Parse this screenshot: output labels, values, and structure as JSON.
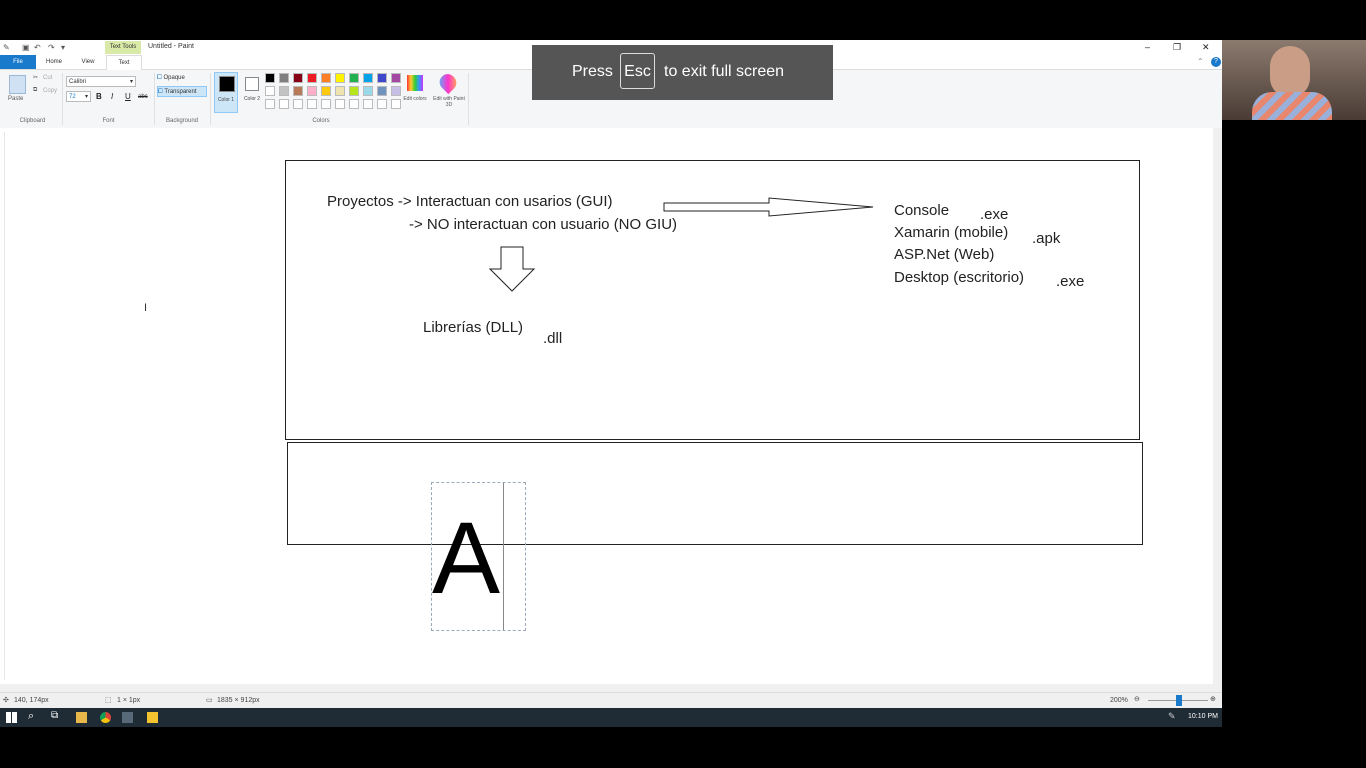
{
  "titlebar": {
    "context_tab": "Text Tools",
    "title": "Untitled - Paint"
  },
  "tabs": {
    "file": "File",
    "home": "Home",
    "view": "View",
    "text": "Text"
  },
  "clipboard": {
    "paste": "Paste",
    "cut": "Cut",
    "copy": "Copy",
    "label": "Clipboard"
  },
  "font": {
    "family": "Calibri",
    "size": "72",
    "bold": "B",
    "italic": "I",
    "underline": "U",
    "strike": "abc",
    "label": "Font"
  },
  "background": {
    "opaque": "Opaque",
    "transparent": "Transparent",
    "label": "Background"
  },
  "colors": {
    "color1": "Color 1",
    "color2": "Color 2",
    "edit_colors": "Edit colors",
    "paint3d": "Edit with Paint 3D",
    "label": "Colors",
    "palette_row1": [
      "#000000",
      "#7f7f7f",
      "#880015",
      "#ed1c24",
      "#ff7f27",
      "#fff200",
      "#22b14c",
      "#00a2e8",
      "#3f48cc",
      "#a349a4"
    ],
    "palette_row2": [
      "#ffffff",
      "#c3c3c3",
      "#b97a57",
      "#ffaec9",
      "#ffc90e",
      "#efe4b0",
      "#b5e61d",
      "#99d9ea",
      "#7092be",
      "#c8bfe7"
    ]
  },
  "toast": {
    "press": "Press",
    "key": "Esc",
    "rest": "to exit full screen"
  },
  "drawing": {
    "line1": "Proyectos -> Interactuan con usarios (GUI)",
    "line2": "-> NO interactuan con usuario (NO GIU)",
    "console": "Console",
    "xamarin": "Xamarin (mobile)",
    "aspnet": "ASP.Net (Web)",
    "desktop": "Desktop (escritorio)",
    "exe1": ".exe",
    "apk": ".apk",
    "exe2": ".exe",
    "librerias": "Librerías (DLL)",
    "dll": ".dll",
    "big_letter": "A"
  },
  "status": {
    "cursor": "140, 174px",
    "selection": "1 × 1px",
    "size": "1835 × 912px",
    "zoom": "200%"
  },
  "taskbar": {
    "time": "10:10 PM"
  }
}
